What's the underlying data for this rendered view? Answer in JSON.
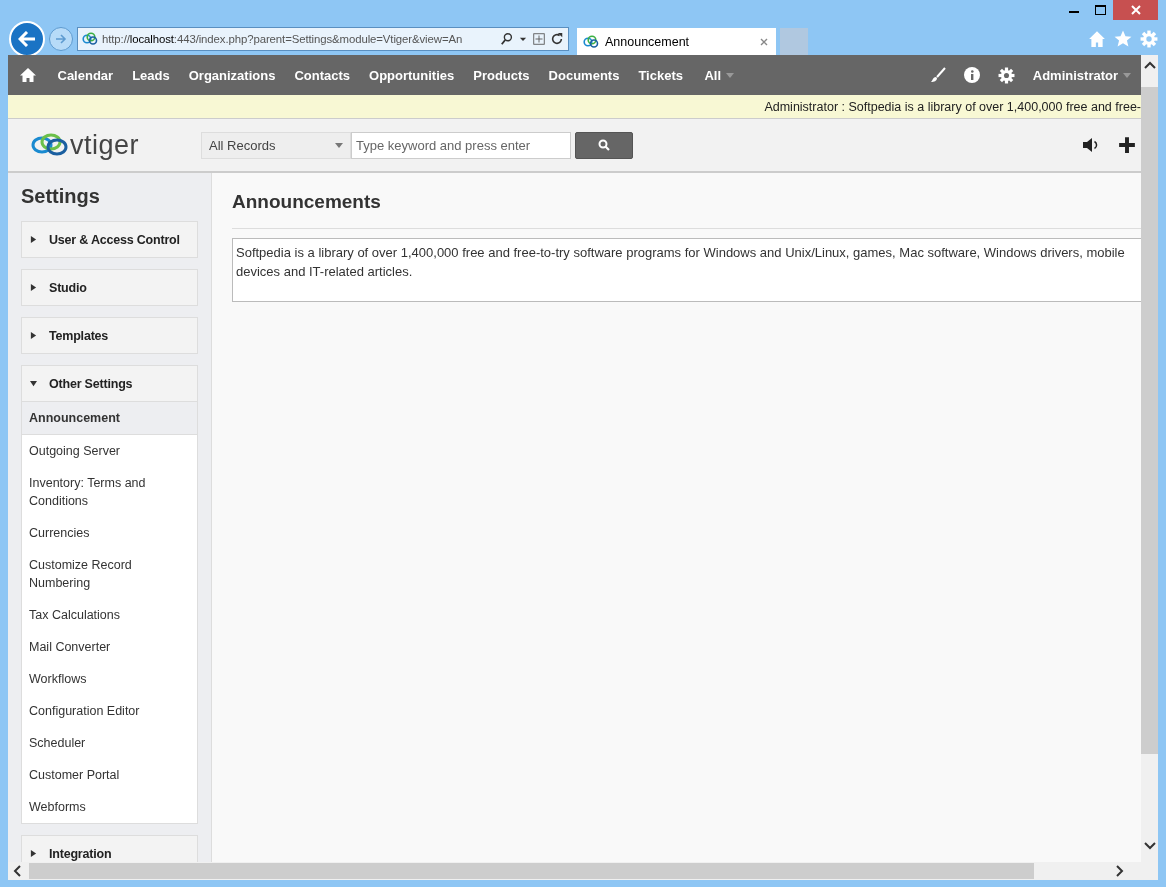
{
  "browser": {
    "address_host": "localhost",
    "address_prefix": "http://",
    "address_rest": ":443/index.php?parent=Settings&module=Vtiger&view=An",
    "tab_title": "Announcement"
  },
  "nav": {
    "items": [
      "Calendar",
      "Leads",
      "Organizations",
      "Contacts",
      "Opportunities",
      "Products",
      "Documents",
      "Tickets"
    ],
    "all_menu": "All",
    "user": "Administrator"
  },
  "announcement_bar": "Administrator : Softpedia is a library of over 1,400,000 free and free-",
  "header": {
    "logo": "vtiger",
    "scope": "All Records",
    "placeholder": "Type keyword and press enter"
  },
  "sidebar": {
    "title": "Settings",
    "groups": [
      {
        "label": "User & Access Control",
        "expanded": false
      },
      {
        "label": "Studio",
        "expanded": false
      },
      {
        "label": "Templates",
        "expanded": false
      },
      {
        "label": "Other Settings",
        "expanded": true,
        "items": [
          {
            "label": "Announcement",
            "selected": true
          },
          {
            "label": "Outgoing Server",
            "selected": false
          },
          {
            "label": "Inventory: Terms and Conditions",
            "selected": false
          },
          {
            "label": "Currencies",
            "selected": false
          },
          {
            "label": "Customize Record Numbering",
            "selected": false
          },
          {
            "label": "Tax Calculations",
            "selected": false
          },
          {
            "label": "Mail Converter",
            "selected": false
          },
          {
            "label": "Workflows",
            "selected": false
          },
          {
            "label": "Configuration Editor",
            "selected": false
          },
          {
            "label": "Scheduler",
            "selected": false
          },
          {
            "label": "Customer Portal",
            "selected": false
          },
          {
            "label": "Webforms",
            "selected": false
          }
        ]
      },
      {
        "label": "Integration",
        "expanded": false
      }
    ]
  },
  "content": {
    "title": "Announcements",
    "announcement_text": "Softpedia is a library of over 1,400,000 free and free-to-try software programs for Windows and Unix/Linux, games, Mac software, Windows drivers, mobile devices and IT-related articles."
  }
}
